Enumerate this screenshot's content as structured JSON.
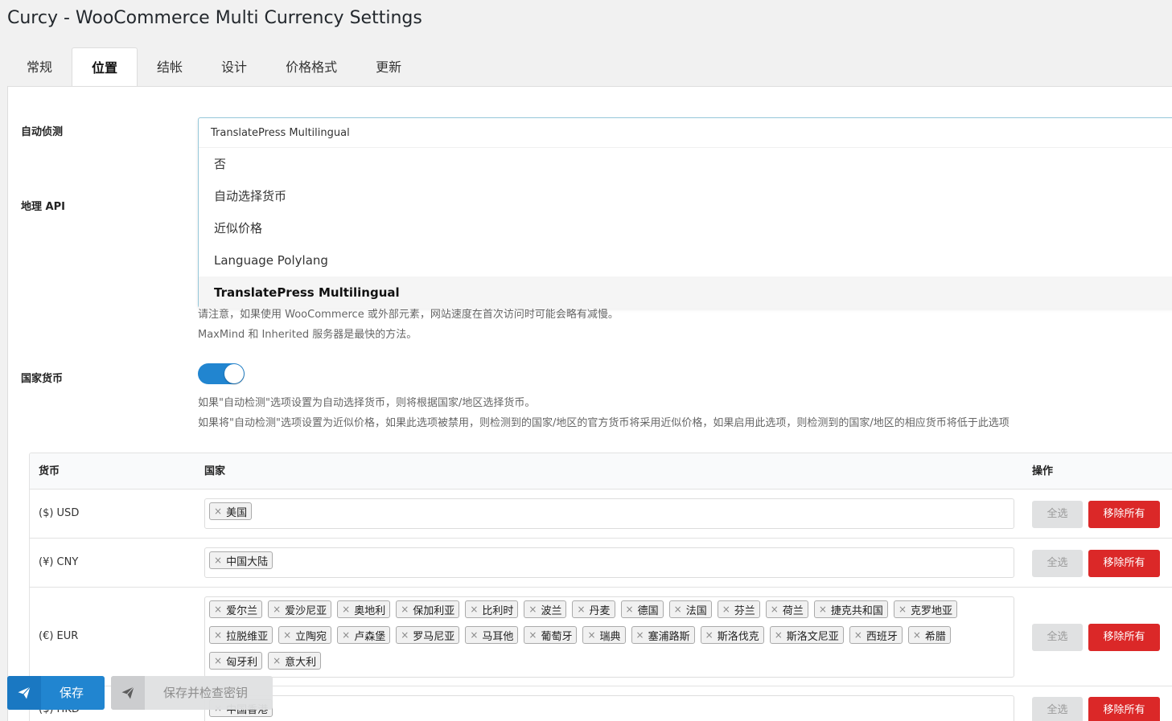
{
  "page": {
    "title": "Curcy - WooCommerce Multi Currency Settings"
  },
  "tabs": [
    {
      "label": "常规"
    },
    {
      "label": "位置"
    },
    {
      "label": "结帐"
    },
    {
      "label": "设计"
    },
    {
      "label": "价格格式"
    },
    {
      "label": "更新"
    }
  ],
  "active_tab": "位置",
  "auto_detect": {
    "label": "自动侦测",
    "current_value": "TranslatePress Multilingual",
    "options": [
      "否",
      "自动选择货币",
      "近似价格",
      "Language Polylang",
      "TranslatePress Multilingual"
    ],
    "selected_option": "TranslatePress Multilingual"
  },
  "geo_api": {
    "label": "地理 API",
    "help_1": "请注意，如果使用 WooCommerce 或外部元素，网站速度在首次访问时可能会略有减慢。",
    "help_2": "MaxMind 和 Inherited 服务器是最快的方法。"
  },
  "country_currency": {
    "label": "国家货币",
    "enabled": true,
    "help_1": "如果\"自动检测\"选项设置为自动选择货币，则将根据国家/地区选择货币。",
    "help_2": "如果将\"自动检测\"选项设置为近似价格，如果此选项被禁用，则检测到的国家/地区的官方货币将采用近似价格，如果启用此选项，则检测到的国家/地区的相应货币将低于此选项"
  },
  "table": {
    "headers": {
      "currency": "货币",
      "country": "国家",
      "action": "操作"
    },
    "select_all_label": "全选",
    "remove_all_label": "移除所有",
    "chip_remove_symbol": "×",
    "rows": [
      {
        "currency": "($) USD",
        "countries": [
          "美国"
        ]
      },
      {
        "currency": "(¥) CNY",
        "countries": [
          "中国大陆"
        ]
      },
      {
        "currency": "(€) EUR",
        "countries": [
          "爱尔兰",
          "爱沙尼亚",
          "奥地利",
          "保加利亚",
          "比利时",
          "波兰",
          "丹麦",
          "德国",
          "法国",
          "芬兰",
          "荷兰",
          "捷克共和国",
          "克罗地亚",
          "拉脱维亚",
          "立陶宛",
          "卢森堡",
          "罗马尼亚",
          "马耳他",
          "葡萄牙",
          "瑞典",
          "塞浦路斯",
          "斯洛伐克",
          "斯洛文尼亚",
          "西班牙",
          "希腊",
          "匈牙利",
          "意大利"
        ]
      },
      {
        "currency": "($) HKD",
        "countries": [
          "中国香港"
        ]
      }
    ]
  },
  "footer": {
    "save_label": "保存",
    "save_check_label": "保存并检查密钥"
  },
  "colors": {
    "primary": "#2185d0",
    "danger": "#db2828",
    "neutral_button": "#e0e1e2"
  }
}
